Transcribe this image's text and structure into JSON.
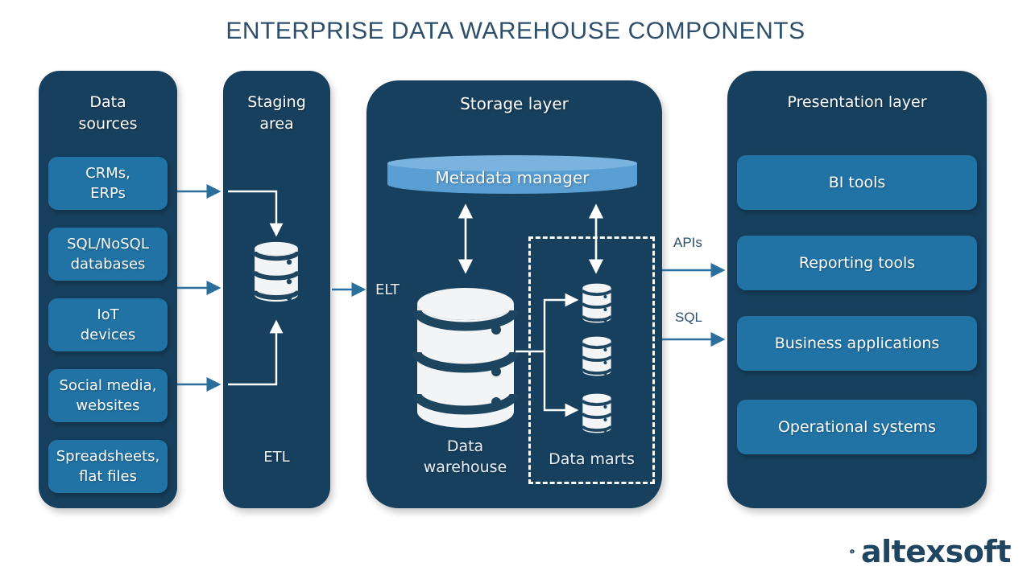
{
  "title": "ENTERPRISE DATA WAREHOUSE COMPONENTS",
  "colors": {
    "panel_bg": "#17405e",
    "chip_bg": "#2173a5",
    "accent_light_blue": "#5a9fd4",
    "arrow_blue": "#2a6f9e",
    "title_navy": "#2d4f6b",
    "icon_white": "#f2f4f5",
    "page_bg": "#ffffff"
  },
  "data_sources": {
    "title": "Data\nsources",
    "items": [
      {
        "label": "CRMs,\nERPs"
      },
      {
        "label": "SQL/NoSQL\ndatabases"
      },
      {
        "label": "IoT\ndevices"
      },
      {
        "label": "Social media,\nwebsites"
      },
      {
        "label": "Spreadsheets,\nflat files"
      }
    ]
  },
  "staging": {
    "title": "Staging\narea",
    "footer": "ETL",
    "icon": "database-icon"
  },
  "storage": {
    "title": "Storage layer",
    "elt_label": "ELT",
    "metadata_manager": "Metadata manager",
    "data_warehouse_label": "Data\nwarehouse",
    "data_marts_label": "Data marts",
    "data_marts_count": 3
  },
  "presentation": {
    "title": "Presentation layer",
    "items": [
      {
        "label": "BI tools"
      },
      {
        "label": "Reporting tools"
      },
      {
        "label": "Business applications"
      },
      {
        "label": "Operational systems"
      }
    ]
  },
  "connectors": {
    "apis_label": "APIs",
    "sql_label": "SQL"
  },
  "logo": {
    "text": "altexsoft",
    "mark": "altexsoft-logo-mark"
  }
}
